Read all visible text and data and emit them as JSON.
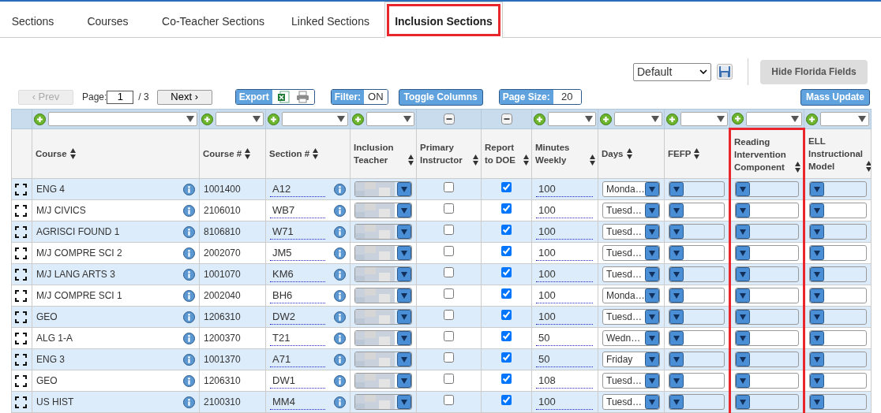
{
  "tabs": [
    {
      "label": "Sections",
      "selected": false,
      "highlighted": false
    },
    {
      "label": "Courses",
      "selected": false,
      "highlighted": false
    },
    {
      "label": "Co-Teacher Sections",
      "selected": false,
      "highlighted": false
    },
    {
      "label": "Linked Sections",
      "selected": false,
      "highlighted": false
    },
    {
      "label": "Inclusion Sections",
      "selected": true,
      "highlighted": true
    }
  ],
  "view": {
    "value": "Default",
    "hide_button": "Hide Florida Fields"
  },
  "toolbar": {
    "prev": "‹ Prev",
    "prev_disabled": true,
    "page_label": "Page:",
    "page": "1",
    "page_total": "/ 3",
    "next": "Next ›",
    "export": "Export",
    "filter_label": "Filter:",
    "filter_value": "ON",
    "toggle_columns": "Toggle Columns",
    "page_size_label": "Page Size:",
    "page_size": "20",
    "mass_update": "Mass Update"
  },
  "columns": [
    {
      "label": "Course",
      "kind": "add",
      "highlighted": false
    },
    {
      "label": "Course #",
      "kind": "add",
      "highlighted": false
    },
    {
      "label": "Section #",
      "kind": "add",
      "highlighted": false
    },
    {
      "label": "Inclusion Teacher",
      "kind": "add",
      "highlighted": false
    },
    {
      "label": "Primary Instructor",
      "kind": "remove",
      "highlighted": false
    },
    {
      "label": "Report to DOE",
      "kind": "remove",
      "highlighted": false
    },
    {
      "label": "Minutes Weekly",
      "kind": "add",
      "highlighted": false
    },
    {
      "label": "Days",
      "kind": "add",
      "highlighted": false
    },
    {
      "label": "FEFP",
      "kind": "add",
      "highlighted": false
    },
    {
      "label": "Reading Intervention Component",
      "kind": "add",
      "highlighted": true
    },
    {
      "label": "ELL Instructional Model",
      "kind": "add",
      "highlighted": false
    }
  ],
  "rows": [
    {
      "course": "ENG 4",
      "course_no": "1001400",
      "section": "A12",
      "primary": false,
      "report": true,
      "minutes": "100",
      "days": "Monda…"
    },
    {
      "course": "M/J CIVICS",
      "course_no": "2106010",
      "section": "WB7",
      "primary": false,
      "report": true,
      "minutes": "100",
      "days": "Tuesd…"
    },
    {
      "course": "AGRISCI FOUND 1",
      "course_no": "8106810",
      "section": "W71",
      "primary": false,
      "report": true,
      "minutes": "100",
      "days": "Tuesd…"
    },
    {
      "course": "M/J COMPRE SCI 2",
      "course_no": "2002070",
      "section": "JM5",
      "primary": false,
      "report": true,
      "minutes": "100",
      "days": "Tuesd…"
    },
    {
      "course": "M/J LANG ARTS 3",
      "course_no": "1001070",
      "section": "KM6",
      "primary": false,
      "report": true,
      "minutes": "100",
      "days": "Tuesd…"
    },
    {
      "course": "M/J COMPRE SCI 1",
      "course_no": "2002040",
      "section": "BH6",
      "primary": false,
      "report": true,
      "minutes": "100",
      "days": "Monda…"
    },
    {
      "course": "GEO",
      "course_no": "1206310",
      "section": "DW2",
      "primary": false,
      "report": true,
      "minutes": "100",
      "days": "Tuesd…"
    },
    {
      "course": "ALG 1-A",
      "course_no": "1200370",
      "section": "T21",
      "primary": false,
      "report": true,
      "minutes": "50",
      "days": "Wedn…"
    },
    {
      "course": "ENG 3",
      "course_no": "1001370",
      "section": "A71",
      "primary": false,
      "report": true,
      "minutes": "50",
      "days": "Friday"
    },
    {
      "course": "GEO",
      "course_no": "1206310",
      "section": "DW1",
      "primary": false,
      "report": true,
      "minutes": "108",
      "days": "Tuesd…"
    },
    {
      "course": "US HIST",
      "course_no": "2100310",
      "section": "MM4",
      "primary": false,
      "report": true,
      "minutes": "100",
      "days": "Tuesd…"
    }
  ]
}
